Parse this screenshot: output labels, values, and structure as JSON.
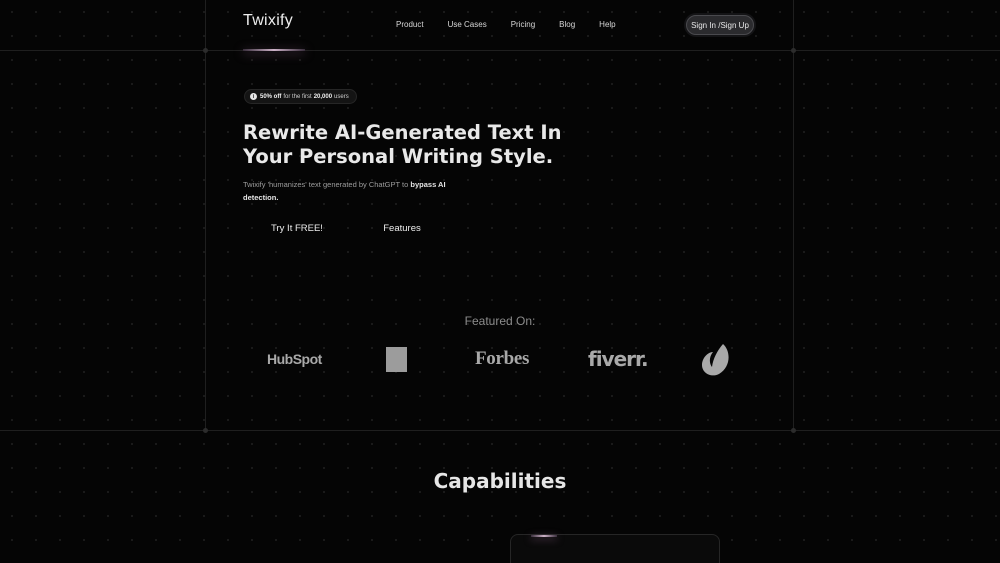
{
  "header": {
    "logo": "Twixify",
    "nav": [
      "Product",
      "Use Cases",
      "Pricing",
      "Blog",
      "Help"
    ],
    "signin_label": "Sign In /Sign Up"
  },
  "promo": {
    "icon": "info-icon",
    "bold_prefix": "50% off",
    "middle": "for the first",
    "bold_count": "20,000",
    "suffix": "users"
  },
  "hero": {
    "title_line1": "Rewrite AI-Generated Text In",
    "title_line2": "Your Personal Writing Style.",
    "subtitle_plain": "Twixify 'humanizes' text generated by ChatGPT to ",
    "subtitle_bold": "bypass AI detection."
  },
  "cta": {
    "primary": "Try It FREE!",
    "secondary": "Features"
  },
  "featured": {
    "label": "Featured On:",
    "logos": [
      "HubSpot",
      "Forbes",
      "fiverr."
    ]
  },
  "capabilities": {
    "title": "Capabilities"
  },
  "colors": {
    "background": "#050505",
    "accent_glow": "#cdb2c8"
  }
}
